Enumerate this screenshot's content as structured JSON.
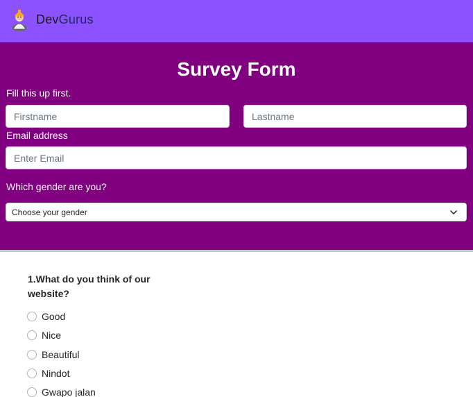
{
  "nav": {
    "brand_part1": "Dev",
    "brand_part2": "Gurus",
    "logo_icon": "guru-mascot-icon"
  },
  "form": {
    "title": "Survey Form",
    "intro_label": "Fill this up first.",
    "firstname_placeholder": "Firstname",
    "lastname_placeholder": "Lastname",
    "email_label": "Email address",
    "email_placeholder": "Enter Email",
    "gender_label": "Which gender are you?",
    "gender_selected": "Choose your gender"
  },
  "survey": {
    "question": "1.What do you think of our website?",
    "options": [
      "Good",
      "Nice",
      "Beautiful",
      "Nindot",
      "Gwapo jalan"
    ]
  },
  "colors": {
    "navbar": "#8c52ff",
    "hero": "#800080"
  }
}
